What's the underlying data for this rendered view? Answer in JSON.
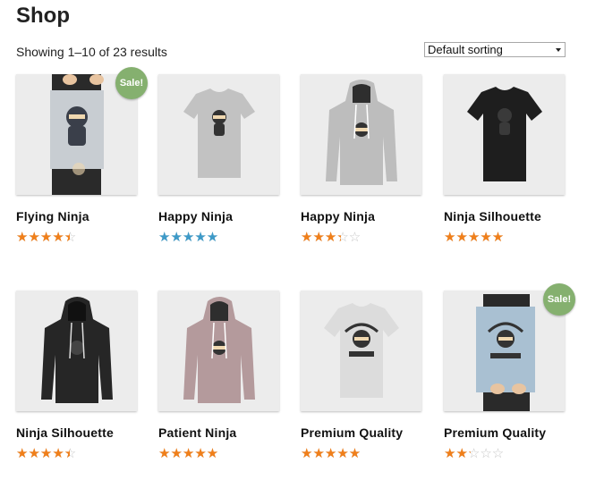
{
  "shop": {
    "title": "Shop",
    "result_count": "Showing 1–10 of 23 results",
    "sort": {
      "selected": "Default sorting"
    }
  },
  "colors": {
    "star_orange": "#f07f1a",
    "star_blue": "#3d9ac8",
    "sale_badge": "#85b06f"
  },
  "products": [
    {
      "name": "Flying Ninja",
      "rating": 4,
      "sale": "Sale!",
      "image": "ninja-poster",
      "star_color": "#f07f1a"
    },
    {
      "name": "Happy Ninja",
      "rating": 5,
      "sale": "",
      "image": "grey-tshirt",
      "star_color": "#3d9ac8"
    },
    {
      "name": "Happy Ninja",
      "rating": 3,
      "sale": "",
      "image": "grey-hoodie",
      "star_color": "#f07f1a"
    },
    {
      "name": "Ninja Silhouette",
      "rating": 5,
      "sale": "",
      "image": "black-tshirt",
      "star_color": "#f07f1a"
    },
    {
      "name": "Ninja Silhouette",
      "rating": 4,
      "sale": "",
      "image": "black-hoodie",
      "star_color": "#f07f1a"
    },
    {
      "name": "Patient Ninja",
      "rating": 5,
      "sale": "",
      "image": "pink-hoodie",
      "star_color": "#f07f1a"
    },
    {
      "name": "Premium Quality",
      "rating": 4.5,
      "sale": "",
      "image": "white-tshirt",
      "star_color": "#f07f1a"
    },
    {
      "name": "Premium Quality",
      "rating": 2,
      "sale": "Sale!",
      "image": "woothemes-poster",
      "star_color": "#f07f1a"
    }
  ]
}
